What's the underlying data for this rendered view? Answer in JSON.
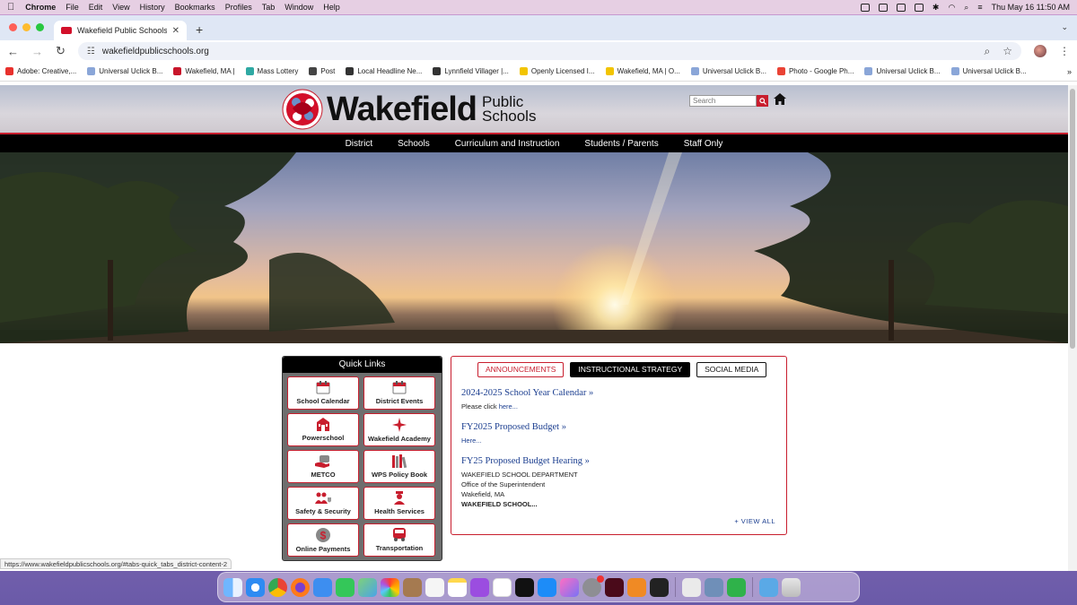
{
  "os_menubar": {
    "app_name": "Chrome",
    "menus": [
      "File",
      "Edit",
      "View",
      "History",
      "Bookmarks",
      "Profiles",
      "Tab",
      "Window",
      "Help"
    ],
    "clock": "Thu May 16  11:50 AM"
  },
  "browser": {
    "tab_title": "Wakefield Public Schools |",
    "url": "wakefieldpublicschools.org",
    "bookmarks": [
      {
        "label": "Adobe: Creative,...",
        "color": "#e8312d"
      },
      {
        "label": "Universal Uclick B...",
        "color": "#8aa6d8"
      },
      {
        "label": "Wakefield, MA |",
        "color": "#c8152a"
      },
      {
        "label": "Mass Lottery",
        "color": "#2fa9a3"
      },
      {
        "label": "Post",
        "color": "#444444"
      },
      {
        "label": "Local Headline Ne...",
        "color": "#333333"
      },
      {
        "label": "Lynnfield Villager |...",
        "color": "#333333"
      },
      {
        "label": "Openly Licensed I...",
        "color": "#f2c400"
      },
      {
        "label": "Wakefield, MA | O...",
        "color": "#f2c400"
      },
      {
        "label": "Universal Uclick B...",
        "color": "#8aa6d8"
      },
      {
        "label": "Photo - Google Ph...",
        "color": "#ea4335"
      },
      {
        "label": "Universal Uclick B...",
        "color": "#8aa6d8"
      },
      {
        "label": "Universal Uclick B...",
        "color": "#8aa6d8"
      }
    ],
    "status_url": "https://www.wakefieldpublicschools.org/#tabs-quick_tabs_district-content-2"
  },
  "site": {
    "logo_word": "Wakefield",
    "logo_sub1": "Public",
    "logo_sub2": "Schools",
    "search_placeholder": "Search",
    "nav": [
      "District",
      "Schools",
      "Curriculum and Instruction",
      "Students / Parents",
      "Staff Only"
    ],
    "quick_links": {
      "title": "Quick Links",
      "items": [
        {
          "label": "School Calendar",
          "icon": "calendar-icon"
        },
        {
          "label": "District Events",
          "icon": "calendar-icon"
        },
        {
          "label": "Powerschool",
          "icon": "school-building-icon"
        },
        {
          "label": "Wakefield Academy",
          "icon": "star-icon"
        },
        {
          "label": "METCO",
          "icon": "bus-hand-icon"
        },
        {
          "label": "WPS Policy Book",
          "icon": "books-icon"
        },
        {
          "label": "Safety & Security",
          "icon": "people-shield-icon"
        },
        {
          "label": "Health Services",
          "icon": "nurse-icon"
        },
        {
          "label": "Online Payments",
          "icon": "dollar-coin-icon"
        },
        {
          "label": "Transportation",
          "icon": "bus-icon"
        }
      ]
    },
    "tabs": {
      "buttons": [
        "ANNOUNCEMENTS",
        "INSTRUCTIONAL STRATEGY",
        "SOCIAL MEDIA"
      ],
      "active_index": 1,
      "announcements": [
        {
          "title": "2024-2025 School Year Calendar »",
          "prefix": "Please click ",
          "link": "here..."
        },
        {
          "title": "FY2025 Proposed Budget »",
          "prefix": "",
          "link": "Here..."
        },
        {
          "title": "FY25 Proposed Budget Hearing »",
          "lines": [
            "WAKEFIELD SCHOOL DEPARTMENT",
            "Office of the Superintendent",
            "Wakefield, MA"
          ],
          "bold": "WAKEFIELD SCHOOL..."
        }
      ],
      "view_all": "+ VIEW ALL"
    }
  },
  "colors": {
    "brand_red": "#c81e2e",
    "link_blue": "#1a3d8f",
    "nav_black": "#000000"
  }
}
